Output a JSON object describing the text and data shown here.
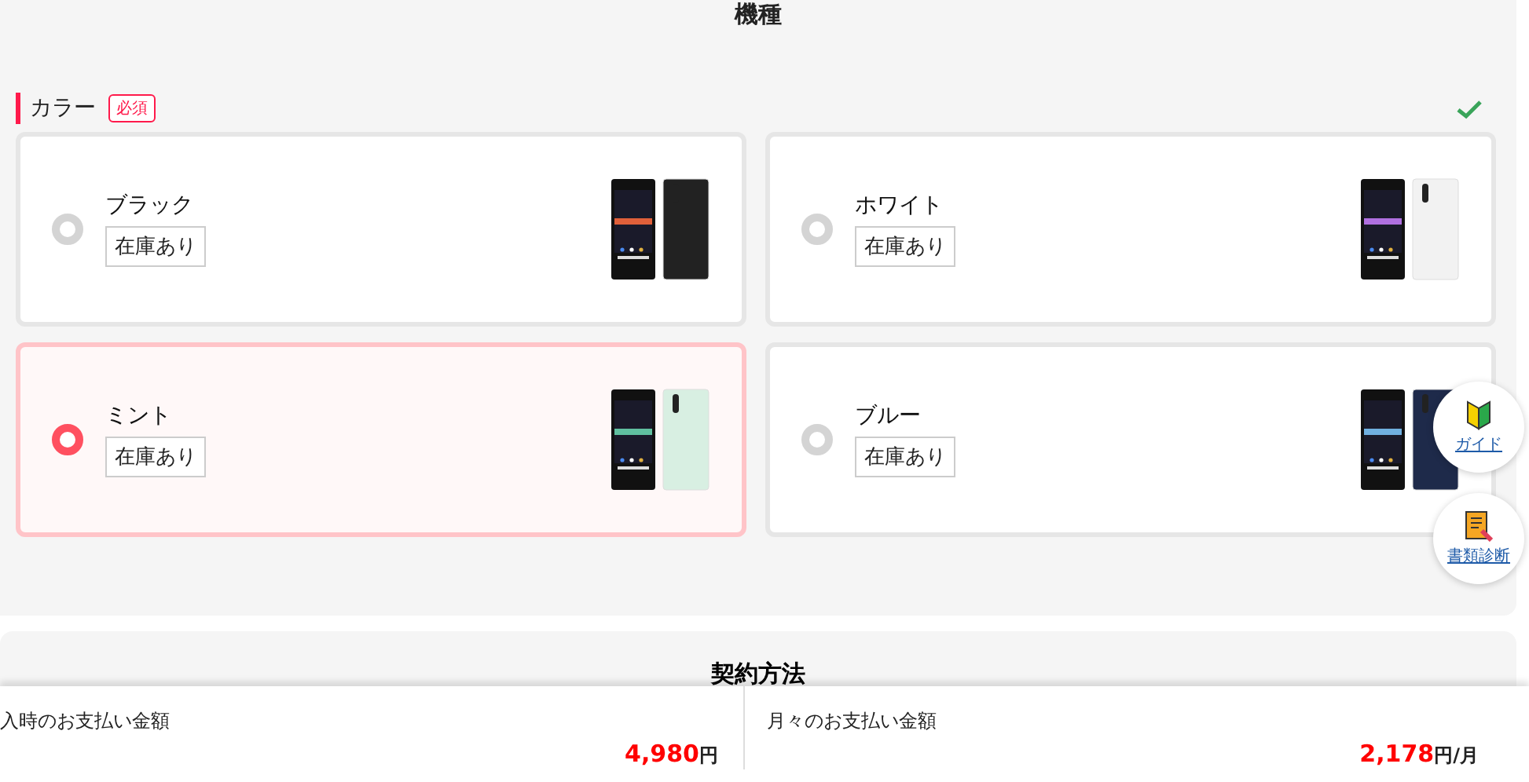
{
  "section_title": "機種",
  "color_group": {
    "label": "カラー",
    "required_badge": "必須",
    "complete": true,
    "options": [
      {
        "name": "ブラック",
        "stock": "在庫あり",
        "selected": false
      },
      {
        "name": "ホワイト",
        "stock": "在庫あり",
        "selected": false
      },
      {
        "name": "ミント",
        "stock": "在庫あり",
        "selected": true
      },
      {
        "name": "ブルー",
        "stock": "在庫あり",
        "selected": false
      }
    ]
  },
  "next_section_title": "契約方法",
  "floating_buttons": [
    {
      "label": "ガイド",
      "kind": "guide"
    },
    {
      "label": "書類診断",
      "kind": "document"
    }
  ],
  "footer": [
    {
      "label": "入時のお支払い金額",
      "amount": "4,980",
      "unit": "円"
    },
    {
      "label": "月々のお支払い金額",
      "amount": "2,178",
      "unit": "円/月"
    }
  ]
}
